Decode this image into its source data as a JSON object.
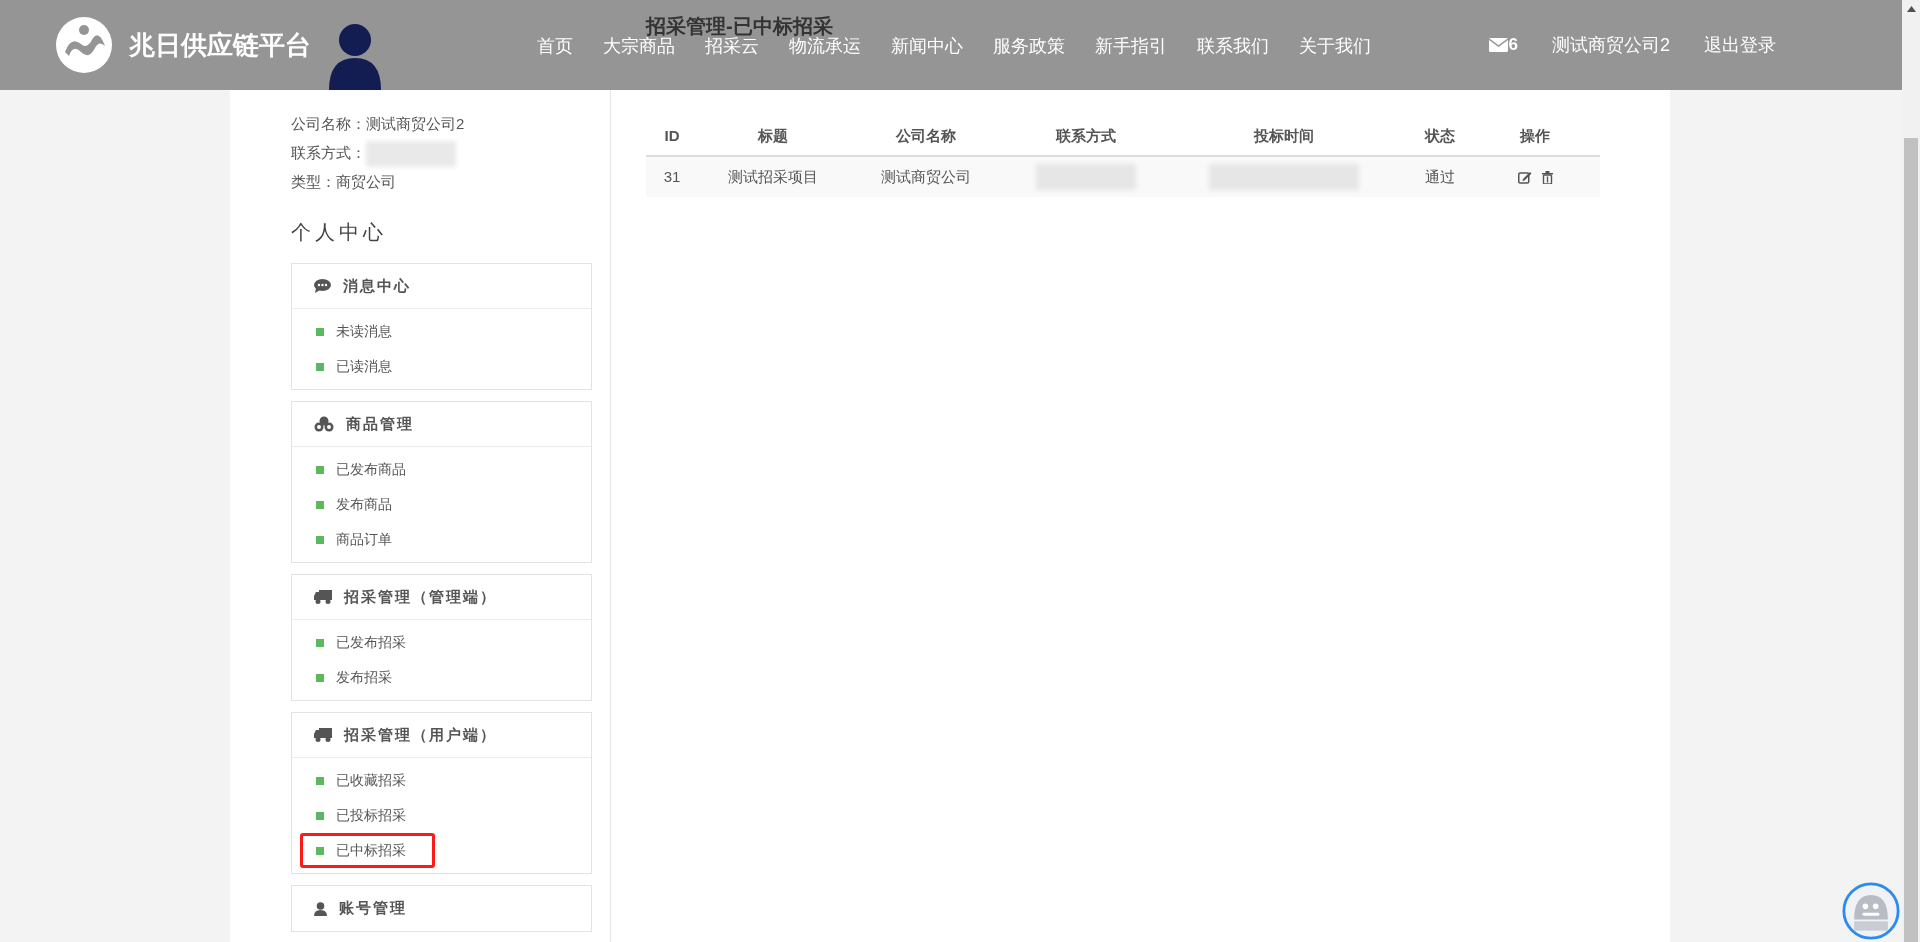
{
  "header": {
    "brand": "兆日供应链平台",
    "nav": [
      {
        "label": "首页"
      },
      {
        "label": "大宗商品"
      },
      {
        "label": "招采云"
      },
      {
        "label": "物流承运"
      },
      {
        "label": "新闻中心"
      },
      {
        "label": "服务政策"
      },
      {
        "label": "新手指引"
      },
      {
        "label": "联系我们"
      },
      {
        "label": "关于我们"
      }
    ],
    "message_count": "6",
    "user": "测试商贸公司2",
    "logout": "退出登录"
  },
  "page_title": "招采管理-已中标招采",
  "profile": [
    {
      "label": "公司名称：",
      "value": "测试商贸公司2"
    },
    {
      "label": "联系方式：",
      "redacted": true
    },
    {
      "label": "类型：",
      "value": "商贸公司"
    }
  ],
  "sidebar": {
    "title": "个人中心",
    "sections": [
      {
        "kind": "chat",
        "title": "消息中心",
        "items": [
          {
            "label": "未读消息",
            "selected": false
          },
          {
            "label": "已读消息",
            "selected": false
          }
        ]
      },
      {
        "kind": "cubes",
        "title": "商品管理",
        "items": [
          {
            "label": "已发布商品",
            "selected": false
          },
          {
            "label": "发布商品",
            "selected": false
          },
          {
            "label": "商品订单",
            "selected": false
          }
        ]
      },
      {
        "kind": "truck",
        "title": "招采管理（管理端）",
        "items": [
          {
            "label": "已发布招采",
            "selected": false
          },
          {
            "label": "发布招采",
            "selected": false
          }
        ]
      },
      {
        "kind": "truck",
        "title": "招采管理（用户端）",
        "items": [
          {
            "label": "已收藏招采",
            "selected": false
          },
          {
            "label": "已投标招采",
            "selected": false
          },
          {
            "label": "已中标招采",
            "selected": true
          }
        ]
      },
      {
        "kind": "user",
        "title": "账号管理"
      }
    ]
  },
  "table": {
    "columns": [
      "ID",
      "标题",
      "公司名称",
      "联系方式",
      "投标时间",
      "状态",
      "操作"
    ],
    "rows": [
      {
        "cells": [
          "31",
          "测试招采项目",
          "测试商贸公司",
          null,
          null,
          "通过"
        ]
      }
    ]
  }
}
